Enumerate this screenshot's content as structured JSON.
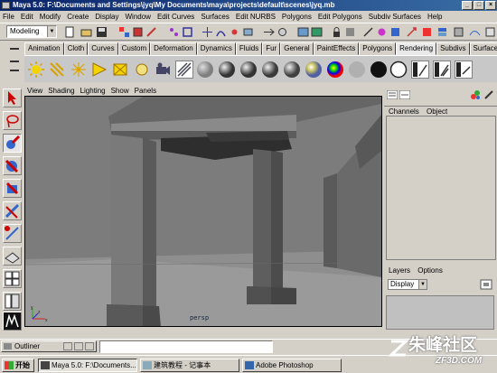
{
  "window": {
    "title": "Maya 5.0: F:\\Documents and Settings\\jyq\\My Documents\\maya\\projects\\default\\scenes\\jyq.mb",
    "min_label": "_",
    "max_label": "□",
    "close_label": "×"
  },
  "menubar": [
    "File",
    "Edit",
    "Modify",
    "Create",
    "Display",
    "Window",
    "Edit Curves",
    "Surfaces",
    "Edit NURBS",
    "Polygons",
    "Edit Polygons",
    "Subdiv Surfaces",
    "Help"
  ],
  "statusline": {
    "mode": "Modeling"
  },
  "shelf": {
    "tabs": [
      "Animation",
      "Cloth",
      "Curves",
      "Custom",
      "Deformation",
      "Dynamics",
      "Fluids",
      "Fur",
      "General",
      "PaintEffects",
      "Polygons",
      "Rendering",
      "Subdivs",
      "Surfaces"
    ],
    "active_tab": "Rendering",
    "sphere_colors": [
      "#808080",
      "#707070",
      "#6a6a6a",
      "#757575",
      "#7e7e7e",
      "#9a9a9a",
      "#c8c8c8",
      "#c84848",
      "#b0b0b0",
      "#111111",
      "#ffffff"
    ]
  },
  "viewport": {
    "menu": [
      "View",
      "Shading",
      "Lighting",
      "Show",
      "Panels"
    ],
    "camera_label": "persp",
    "axis_x": "x",
    "axis_y": "y",
    "axis_z": "z"
  },
  "channelbox": {
    "tabs": [
      "Channels",
      "Object"
    ],
    "layers_tabs": [
      "Layers",
      "Options"
    ],
    "display_value": "Display"
  },
  "commandline": {
    "outliner_label": "Outliner"
  },
  "taskbar": {
    "start_label": "开始",
    "items": [
      "Maya 5.0: F:\\Documents...",
      "建筑教程 - 记事本",
      "Adobe Photoshop"
    ]
  },
  "watermark": {
    "text": "朱峰社区",
    "sub": "ZF3D.COM"
  }
}
